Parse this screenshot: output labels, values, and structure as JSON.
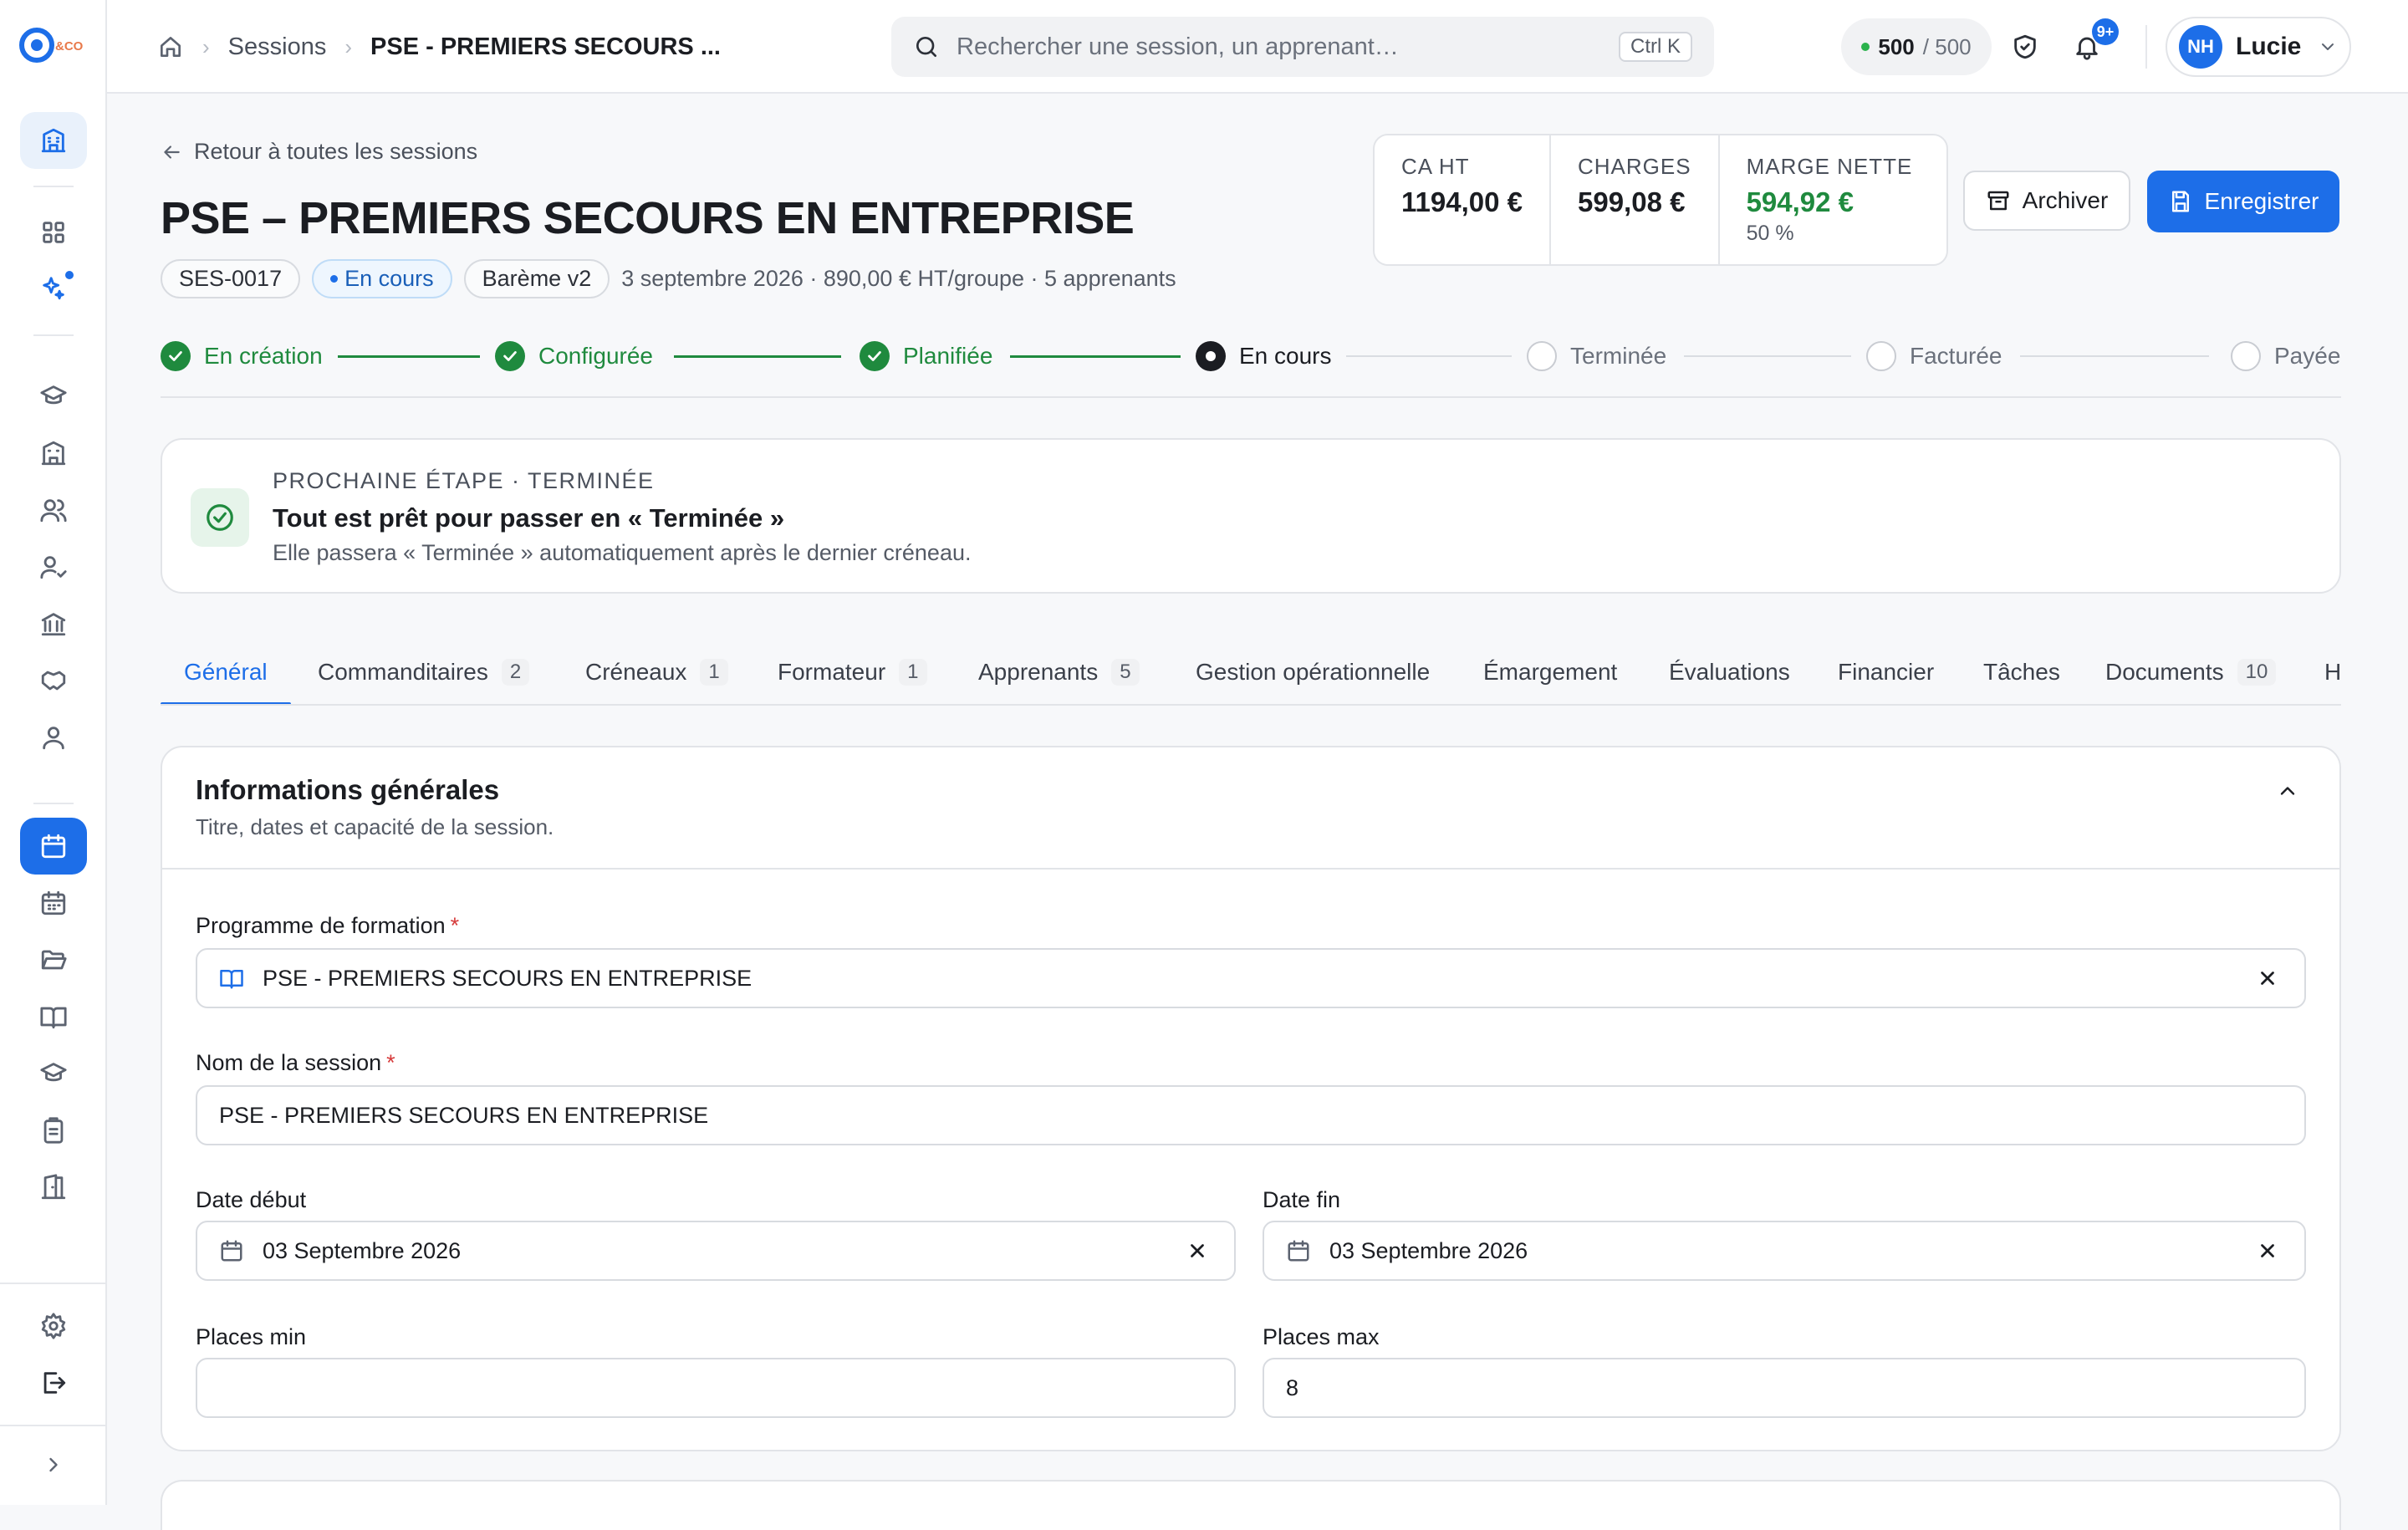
{
  "app": {
    "name": "CO&CO"
  },
  "breadcrumbs": {
    "sessions": "Sessions",
    "current": "PSE - PREMIERS SECOURS ..."
  },
  "search": {
    "placeholder": "Rechercher une session, un apprenant…",
    "shortcut": "Ctrl K"
  },
  "quota": {
    "used": "500",
    "total": "/ 500"
  },
  "notifications": {
    "badge": "9+"
  },
  "user": {
    "initials": "NH",
    "name": "Lucie"
  },
  "page": {
    "back_link": "Retour à toutes les sessions",
    "title": "PSE – PREMIERS SECOURS EN ENTREPRISE",
    "code": "SES-0017",
    "status": "En cours",
    "bareme": "Barème v2",
    "summary": "3 septembre 2026 · 890,00 € HT/groupe · 5 apprenants"
  },
  "stats": [
    {
      "label": "CA HT",
      "value": "1194,00 €"
    },
    {
      "label": "CHARGES",
      "value": "599,08 €"
    },
    {
      "label": "MARGE NETTE",
      "value": "594,92 €",
      "sub": "50 %"
    }
  ],
  "actions": {
    "archive": "Archiver",
    "save": "Enregistrer"
  },
  "steps": [
    {
      "label": "En création",
      "state": "done"
    },
    {
      "label": "Configurée",
      "state": "done"
    },
    {
      "label": "Planifiée",
      "state": "done"
    },
    {
      "label": "En cours",
      "state": "current"
    },
    {
      "label": "Terminée",
      "state": "todo"
    },
    {
      "label": "Facturée",
      "state": "todo"
    },
    {
      "label": "Payée",
      "state": "todo"
    }
  ],
  "next_step": {
    "eyebrow": "PROCHAINE ÉTAPE · TERMINÉE",
    "title": "Tout est prêt pour passer en « Terminée »",
    "description": "Elle passera « Terminée » automatiquement après le dernier créneau."
  },
  "tabs": [
    {
      "label": "Général",
      "count": ""
    },
    {
      "label": "Commanditaires",
      "count": "2"
    },
    {
      "label": "Créneaux",
      "count": "1"
    },
    {
      "label": "Formateur",
      "count": "1"
    },
    {
      "label": "Apprenants",
      "count": "5"
    },
    {
      "label": "Gestion opérationnelle",
      "count": ""
    },
    {
      "label": "Émargement",
      "count": ""
    },
    {
      "label": "Évaluations",
      "count": ""
    },
    {
      "label": "Financier",
      "count": ""
    },
    {
      "label": "Tâches",
      "count": ""
    },
    {
      "label": "Documents",
      "count": "10"
    },
    {
      "label": "H",
      "count": ""
    }
  ],
  "general": {
    "title": "Informations générales",
    "subtitle": "Titre, dates et capacité de la session.",
    "programme_label": "Programme de formation",
    "programme_value": "PSE - PREMIERS SECOURS EN ENTREPRISE",
    "name_label": "Nom de la session",
    "name_value": "PSE - PREMIERS SECOURS EN ENTREPRISE",
    "date_start_label": "Date début",
    "date_start_value": "03 Septembre 2026",
    "date_end_label": "Date fin",
    "date_end_value": "03 Septembre 2026",
    "places_min_label": "Places min",
    "places_min_value": "",
    "places_max_label": "Places max",
    "places_max_value": "8"
  },
  "colors": {
    "primary": "#1d6ee8",
    "success": "#1f8a3e",
    "required": "#d63a3a"
  }
}
